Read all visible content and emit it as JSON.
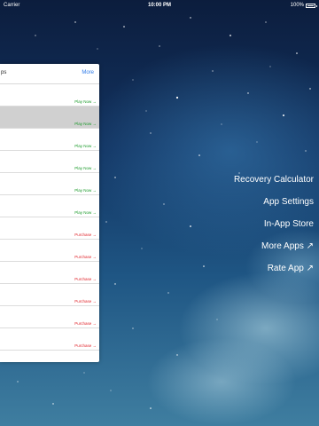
{
  "status_bar": {
    "carrier": "Carrier",
    "time": "10:00 PM",
    "battery": "100%"
  },
  "panel": {
    "title": "ps",
    "more_label": "More",
    "rows": [
      {
        "action": "Play Now →",
        "kind": "play",
        "selected": false
      },
      {
        "action": "Play Now →",
        "kind": "play",
        "selected": true
      },
      {
        "action": "Play Now →",
        "kind": "play",
        "selected": false
      },
      {
        "action": "Play Now →",
        "kind": "play",
        "selected": false
      },
      {
        "action": "Play Now →",
        "kind": "play",
        "selected": false
      },
      {
        "action": "Play Now →",
        "kind": "play",
        "selected": false
      },
      {
        "action": "Purchase →",
        "kind": "buy",
        "selected": false
      },
      {
        "action": "Purchase →",
        "kind": "buy",
        "selected": false
      },
      {
        "action": "Purchase →",
        "kind": "buy",
        "selected": false
      },
      {
        "action": "Purchase →",
        "kind": "buy",
        "selected": false
      },
      {
        "action": "Purchase →",
        "kind": "buy",
        "selected": false
      },
      {
        "action": "Purchase →",
        "kind": "buy",
        "selected": false
      }
    ]
  },
  "menu": [
    {
      "label": "Recovery Calculator"
    },
    {
      "label": "App Settings"
    },
    {
      "label": "In-App Store"
    },
    {
      "label": "More Apps ↗"
    },
    {
      "label": "Rate App ↗"
    }
  ],
  "colors": {
    "play": "#1a9a2a",
    "purchase": "#e0242b",
    "link": "#2f7be8"
  }
}
